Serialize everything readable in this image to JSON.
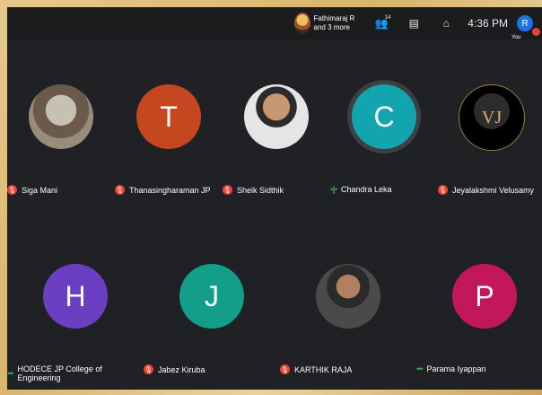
{
  "topbar": {
    "host_line1": "Fathimaraj R",
    "host_line2": "and 3 more",
    "people_icon": "people-icon",
    "people_count": "14",
    "chat_icon": "chat-icon",
    "activities_icon": "activities-icon",
    "time": "4:36 PM",
    "me_initial": "R",
    "me_label": "You"
  },
  "participants_row1": [
    {
      "name": "Siga Mani",
      "initial": "",
      "status": "muted"
    },
    {
      "name": "Thanasingharaman JP",
      "initial": "T",
      "status": "muted",
      "color": "#c5471f"
    },
    {
      "name": "Sheik Sidthik",
      "initial": "",
      "status": "muted"
    },
    {
      "name": "Chandra Leka",
      "initial": "C",
      "status": "speaking",
      "color": "#12a4af"
    },
    {
      "name": "Jeyalakshmi Velusamy",
      "initial": "VJ",
      "status": "muted"
    }
  ],
  "participants_row2": [
    {
      "name": "HODECE JP College of Engineering",
      "initial": "H",
      "status": "active",
      "color": "#6a3fc2"
    },
    {
      "name": "Jabez Kiruba",
      "initial": "J",
      "status": "muted",
      "color": "#129e88"
    },
    {
      "name": "KARTHIK RAJA",
      "initial": "",
      "status": "muted"
    },
    {
      "name": "Parama Iyappan",
      "initial": "P",
      "status": "active",
      "color": "#c2185b"
    }
  ]
}
